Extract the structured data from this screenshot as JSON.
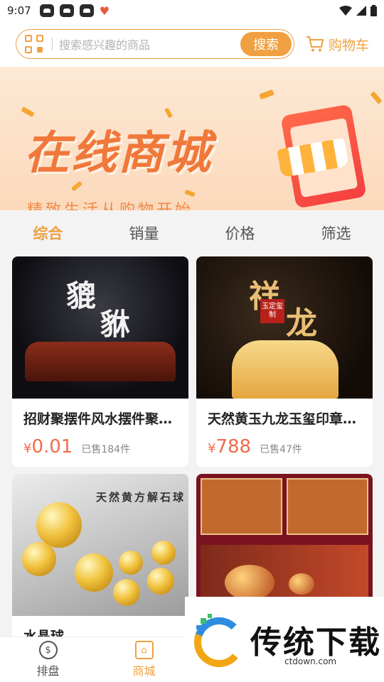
{
  "status_bar": {
    "time": "9:07"
  },
  "search": {
    "placeholder": "搜索感兴趣的商品",
    "button_label": "搜索"
  },
  "cart": {
    "label": "购物车"
  },
  "banner": {
    "title": "在线商城",
    "subtitle": "精致生活从购物开始"
  },
  "tabs": [
    {
      "label": "综合",
      "active": true
    },
    {
      "label": "销量",
      "active": false
    },
    {
      "label": "价格",
      "active": false
    },
    {
      "label": "筛选",
      "active": false
    }
  ],
  "products": [
    {
      "name": "招财聚摆件风水摆件聚…",
      "currency": "¥",
      "price": "0.01",
      "sold": "已售184件",
      "image_text": [
        "貔",
        "貅"
      ]
    },
    {
      "name": "天然黄玉九龙玉玺印章…",
      "currency": "¥",
      "price": "788",
      "sold": "已售47件",
      "image_text": [
        "祥",
        "龙"
      ],
      "stamp": "玉定玺制"
    },
    {
      "name": "水晶球",
      "image_text": "天然黄方解石球"
    },
    {
      "name": "",
      "image_text": ""
    }
  ],
  "bottom_nav": [
    {
      "label": "排盘",
      "icon": "compass-icon",
      "active": false
    },
    {
      "label": "商城",
      "icon": "shop-icon",
      "active": true
    }
  ],
  "watermark": {
    "title": "传统下载",
    "url": "ctdown.com"
  },
  "colors": {
    "accent": "#f0a040",
    "price": "#f26b4a"
  }
}
